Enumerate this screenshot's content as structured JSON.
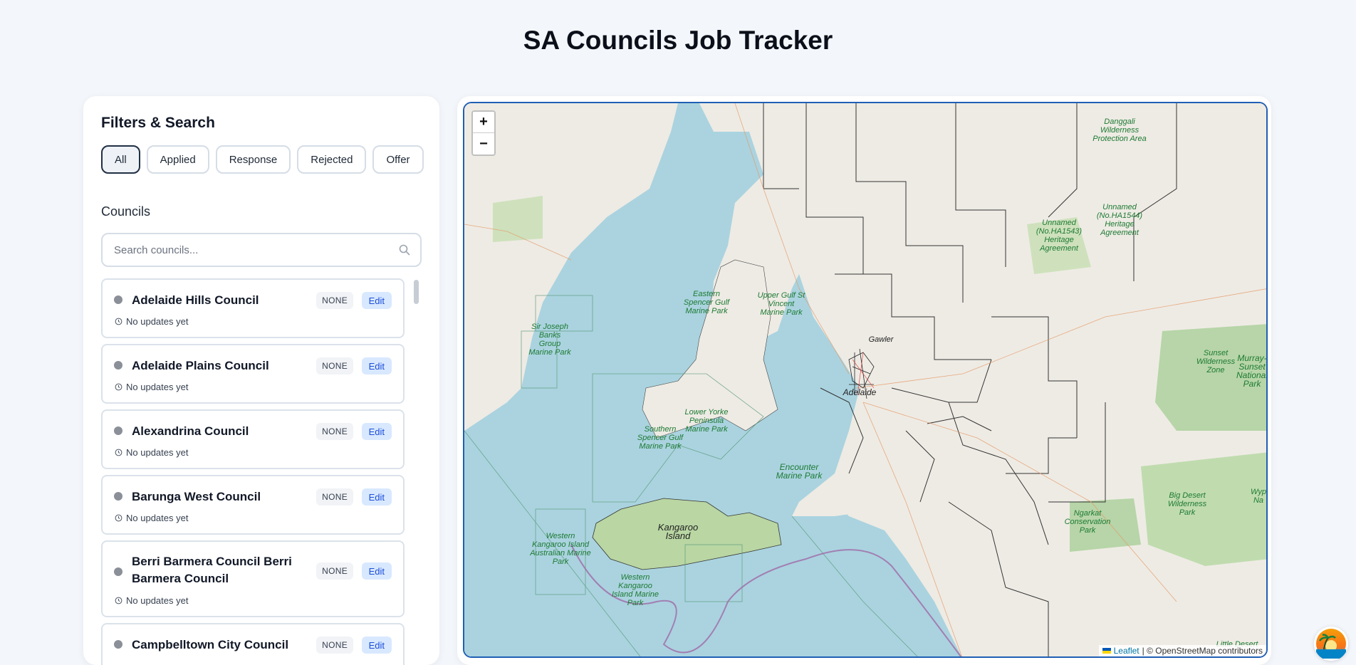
{
  "header": {
    "title": "SA Councils Job Tracker"
  },
  "sidebar": {
    "title": "Filters & Search",
    "filters": [
      "All",
      "Applied",
      "Response",
      "Rejected",
      "Offer"
    ],
    "active_filter": "All",
    "councils_heading": "Councils",
    "search": {
      "placeholder": "Search councils...",
      "value": ""
    },
    "councils": [
      {
        "name": "Adelaide Hills Council",
        "status": "NONE",
        "edit": "Edit",
        "updated": "No updates yet"
      },
      {
        "name": "Adelaide Plains Council",
        "status": "NONE",
        "edit": "Edit",
        "updated": "No updates yet"
      },
      {
        "name": "Alexandrina Council",
        "status": "NONE",
        "edit": "Edit",
        "updated": "No updates yet"
      },
      {
        "name": "Barunga West Council",
        "status": "NONE",
        "edit": "Edit",
        "updated": "No updates yet"
      },
      {
        "name": "Berri Barmera Council Berri Barmera Council",
        "status": "NONE",
        "edit": "Edit",
        "updated": "No updates yet"
      },
      {
        "name": "Campbelltown City Council",
        "status": "NONE",
        "edit": "Edit",
        "updated": ""
      }
    ]
  },
  "map": {
    "zoom_in": "+",
    "zoom_out": "−",
    "attribution_link": "Leaflet",
    "attribution_text": "| © OpenStreetMap contributors",
    "labels": {
      "kangaroo_island": "Kangaroo Island",
      "encounter": "Encounter Marine Park",
      "lower_yorke": "Lower Yorke Peninsula Marine Park",
      "southern_spencer": "Southern Spencer Gulf Marine Park",
      "eastern_spencer": "Eastern Spencer Gulf Marine Park",
      "upper_gulf": "Upper Gulf St Vincent Marine Park",
      "sir_joseph": "Sir Joseph Banks Group Marine Park",
      "western_ki_1": "Western Kangaroo Island Australian Marine Park",
      "western_ki_2": "Western Kangaroo Island Marine Park",
      "danggali": "Danggali Wilderness Protection Area",
      "ha1543": "Unnamed (No.HA1543) Heritage Agreement",
      "ha1544": "Unnamed (No.HA1544) Heritage Agreement",
      "sunset": "Sunset Wilderness Zone",
      "murray_sunset": "Murray-Sunset National Park",
      "big_desert": "Big Desert Wilderness Park",
      "ngarkat": "Ngarkat Conservation Park",
      "wyp": "Wyp Na",
      "little_desert": "Little Desert",
      "gawler": "Gawler",
      "adelaide": "Adelaide"
    }
  },
  "colors": {
    "accent": "#1d4ed8",
    "water": "#aad3df",
    "land": "#f2efe9",
    "park": "#c8e0b4"
  }
}
